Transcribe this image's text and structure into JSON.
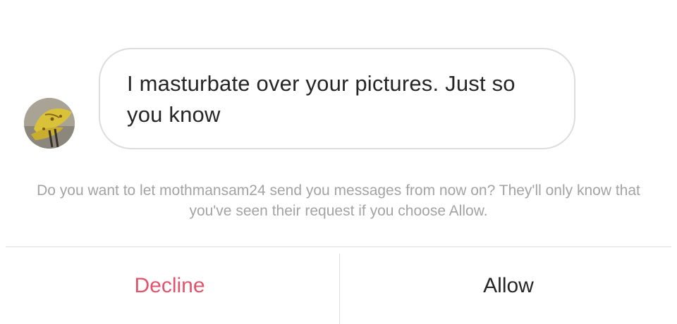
{
  "message": {
    "sender_username": "mothmansam24",
    "text": "I masturbate over your pictures. Just so you know",
    "avatar_icon": "moth-photo-avatar"
  },
  "request": {
    "prompt": "Do you want to let mothmansam24 send you messages from now on? They'll only know that you've seen their request if you choose Allow."
  },
  "actions": {
    "decline_label": "Decline",
    "allow_label": "Allow"
  },
  "colors": {
    "decline": "#e0556b",
    "allow": "#262626",
    "message_text": "#262626",
    "prompt_text": "#a3a3a3",
    "bubble_border": "#dcdcdc",
    "divider": "#dedede"
  }
}
